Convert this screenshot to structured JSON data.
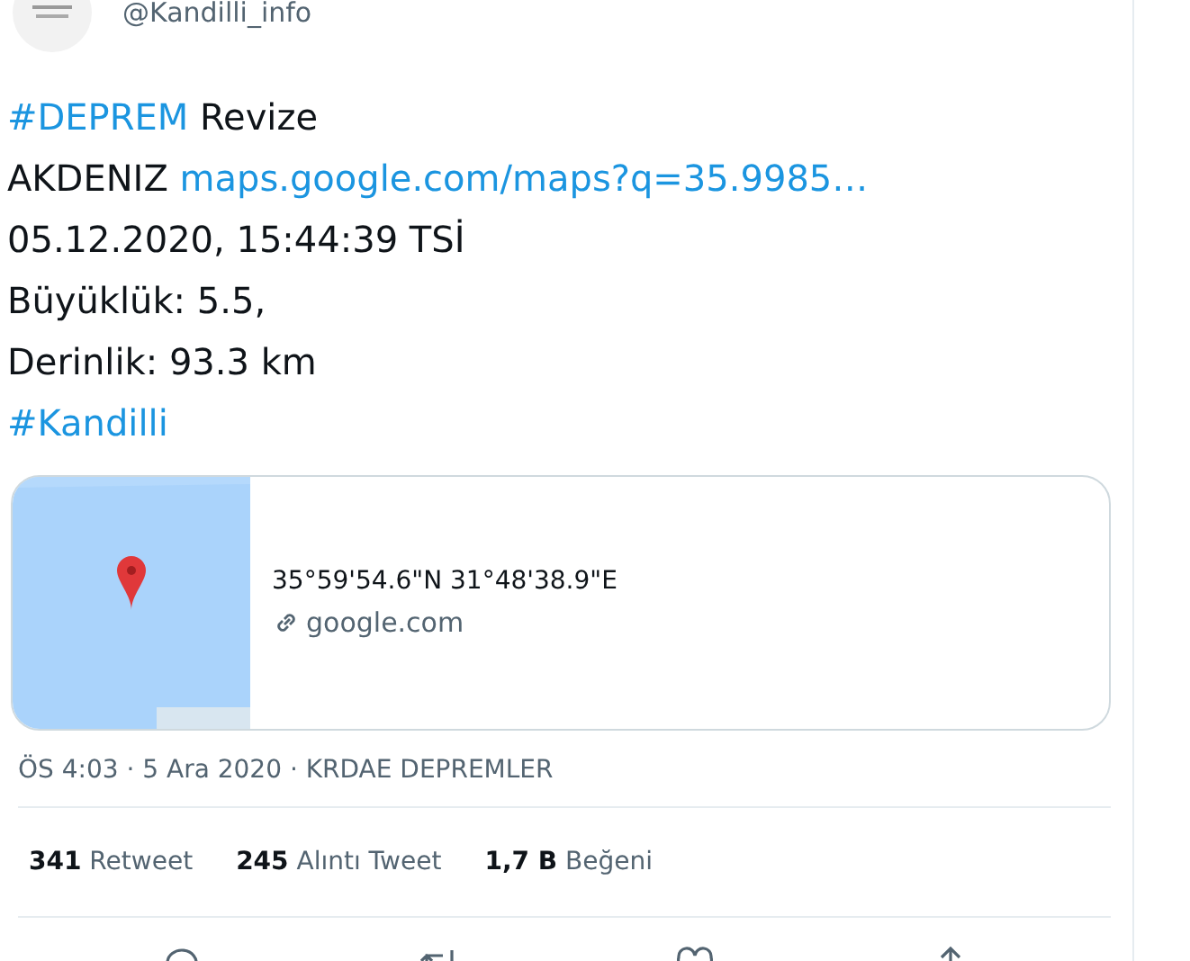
{
  "author": {
    "handle": "@Kandilli_info"
  },
  "body": [
    {
      "kind": "mixed",
      "parts": [
        {
          "text": "#DEPREM",
          "link": true
        },
        {
          "text": " Revize",
          "link": false
        }
      ]
    },
    {
      "kind": "mixed",
      "parts": [
        {
          "text": "AKDENIZ ",
          "link": false
        },
        {
          "text": "maps.google.com/maps?q=35.9985…",
          "link": true
        }
      ]
    },
    {
      "kind": "mixed",
      "parts": [
        {
          "text": "05.12.2020, 15:44:39 TSİ",
          "link": false
        }
      ]
    },
    {
      "kind": "mixed",
      "parts": [
        {
          "text": "Büyüklük: 5.5,",
          "link": false
        }
      ]
    },
    {
      "kind": "mixed",
      "parts": [
        {
          "text": "Derinlik: 93.3 km",
          "link": false
        }
      ]
    },
    {
      "kind": "mixed",
      "parts": [
        {
          "text": "#Kandilli",
          "link": true
        }
      ]
    }
  ],
  "card": {
    "title": "35°59'54.6\"N 31°48'38.9\"E",
    "domain": "google.com"
  },
  "meta": "ÖS 4:03 · 5 Ara 2020 · KRDAE DEPREMLER",
  "stats": [
    {
      "count": "341",
      "label": "Retweet"
    },
    {
      "count": "245",
      "label": "Alıntı Tweet"
    },
    {
      "count": "1,7 B",
      "label": "Beğeni"
    }
  ]
}
